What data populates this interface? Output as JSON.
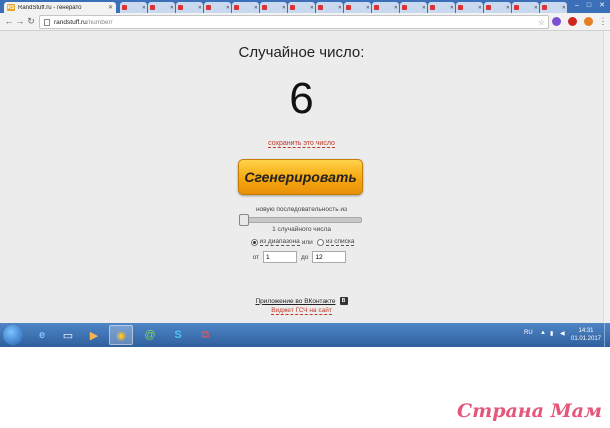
{
  "browser": {
    "active_tab_title": "RandStuff.ru - генерато",
    "active_tab_favicon": "RS",
    "url_host": "randstuff.ru",
    "url_path": "/number/",
    "window_controls": [
      "–",
      "□",
      "✕"
    ]
  },
  "page": {
    "title": "Случайное число:",
    "result": "6",
    "save_link": "сохранить это число",
    "generate_button": "Сгенерировать",
    "sequence_label": "новую последовательность из",
    "count_label": "1 случайного числа",
    "mode_range": "из диапазона",
    "mode_or": "или",
    "mode_list": "из списка",
    "from_label": "от",
    "from_value": "1",
    "to_label": "до",
    "to_value": "12",
    "vk_app_link": "Приложение во ВКонтакте",
    "vk_icon": "B",
    "widget_link": "Виджет ГСЧ на сайт"
  },
  "taskbar": {
    "lang": "RU",
    "time": "14:31",
    "date": "01.01.2017"
  },
  "watermark": "Страна Мам"
}
